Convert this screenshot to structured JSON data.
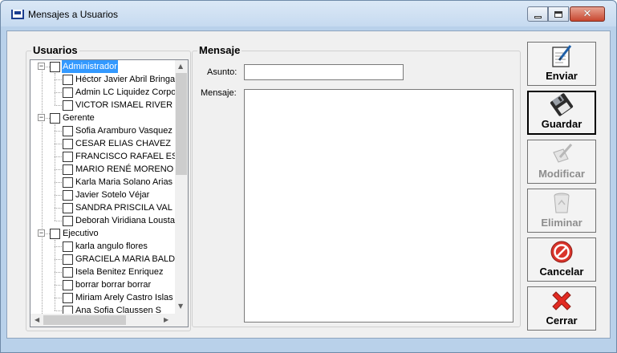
{
  "window": {
    "title": "Mensajes a Usuarios",
    "controls": {
      "minimize": "",
      "maximize": "",
      "close": "✕"
    }
  },
  "users_panel": {
    "title": "Usuarios",
    "groups": [
      {
        "label": "Administrador",
        "selected": true,
        "users": [
          "Héctor Javier Abril Bringa",
          "Admin LC Liquidez Corpo",
          "VICTOR ISMAEL RIVER"
        ]
      },
      {
        "label": "Gerente",
        "selected": false,
        "users": [
          "Sofia Aramburo Vasquez",
          "CESAR ELIAS CHAVEZ",
          "FRANCISCO RAFAEL ES",
          "MARIO RENÉ MORENO",
          "Karla Maria Solano Arias",
          "Javier  Sotelo Véjar",
          "SANDRA PRISCILA VAL",
          "Deborah Viridiana Lousta"
        ]
      },
      {
        "label": "Ejecutivo",
        "selected": false,
        "users": [
          "karla angulo flores",
          "GRACIELA MARIA BALD",
          "Isela Benitez Enriquez",
          "borrar borrar borrar",
          "Miriam Arely Castro Islas",
          "Ana Sofia Claussen S"
        ]
      }
    ]
  },
  "message_panel": {
    "title": "Mensaje",
    "subject_label": "Asunto:",
    "subject_value": "",
    "message_label": "Mensaje:",
    "message_value": ""
  },
  "actions": [
    {
      "id": "enviar",
      "label": "Enviar",
      "icon": "notepad-pencil-icon",
      "enabled": true,
      "primary": false
    },
    {
      "id": "guardar",
      "label": "Guardar",
      "icon": "floppy-disk-icon",
      "enabled": true,
      "primary": true
    },
    {
      "id": "modificar",
      "label": "Modificar",
      "icon": "edit-icon",
      "enabled": false,
      "primary": false
    },
    {
      "id": "eliminar",
      "label": "Eliminar",
      "icon": "recycle-bin-icon",
      "enabled": false,
      "primary": false
    },
    {
      "id": "cancelar",
      "label": "Cancelar",
      "icon": "no-entry-icon",
      "enabled": true,
      "primary": false
    },
    {
      "id": "cerrar",
      "label": "Cerrar",
      "icon": "red-x-icon",
      "enabled": true,
      "primary": false
    }
  ],
  "colors": {
    "selection": "#3399ff",
    "window_frame": "#b9d1ea",
    "close_button": "#c8472f",
    "disabled_text": "#8d8d8d"
  }
}
